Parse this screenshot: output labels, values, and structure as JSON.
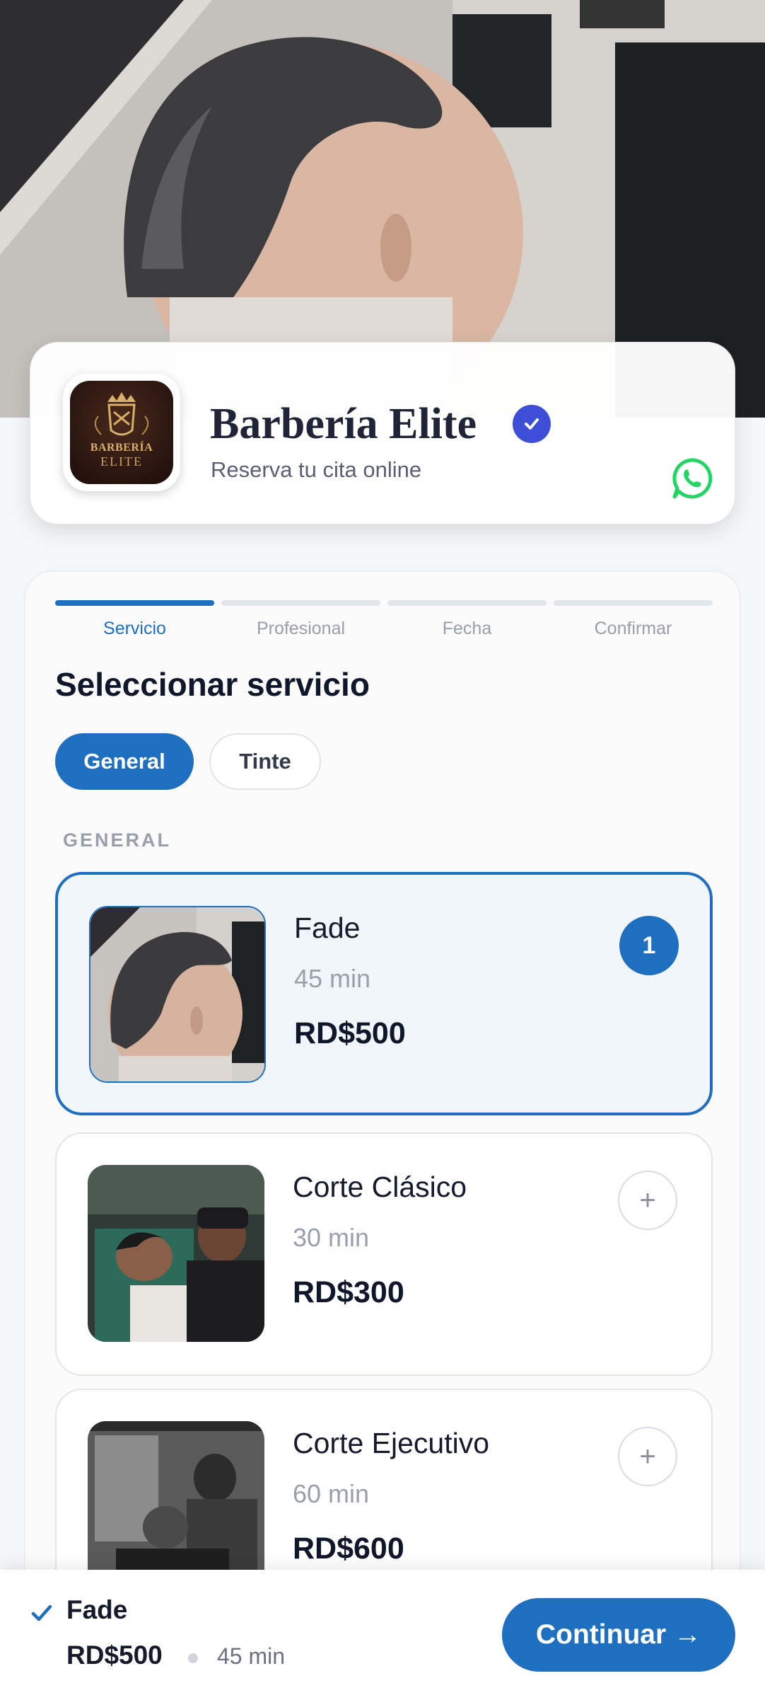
{
  "brand": {
    "name": "Barbería Elite",
    "tagline": "Reserva tu cita online",
    "logo_line1": "BARBERÍA",
    "logo_line2": "ELITE",
    "accent_color": "#1f6fc0",
    "verified_color": "#3d4fd6",
    "whatsapp_color": "#25d366"
  },
  "steps": [
    {
      "label": "Servicio",
      "active": true
    },
    {
      "label": "Profesional",
      "active": false
    },
    {
      "label": "Fecha",
      "active": false
    },
    {
      "label": "Confirmar",
      "active": false
    }
  ],
  "section_title": "Seleccionar servicio",
  "categories": [
    {
      "label": "General",
      "selected": true
    },
    {
      "label": "Tinte",
      "selected": false
    }
  ],
  "group_label": "GENERAL",
  "services": [
    {
      "name": "Fade",
      "duration": "45 min",
      "price": "RD$500",
      "selected": true,
      "count": "1"
    },
    {
      "name": "Corte Clásico",
      "duration": "30 min",
      "price": "RD$300",
      "selected": false,
      "add_symbol": "+"
    },
    {
      "name": "Corte Ejecutivo",
      "duration": "60 min",
      "price": "RD$600",
      "selected": false,
      "add_symbol": "+"
    }
  ],
  "summary": {
    "name": "Fade",
    "price": "RD$500",
    "duration": "45 min",
    "continue_label": "Continuar →"
  }
}
